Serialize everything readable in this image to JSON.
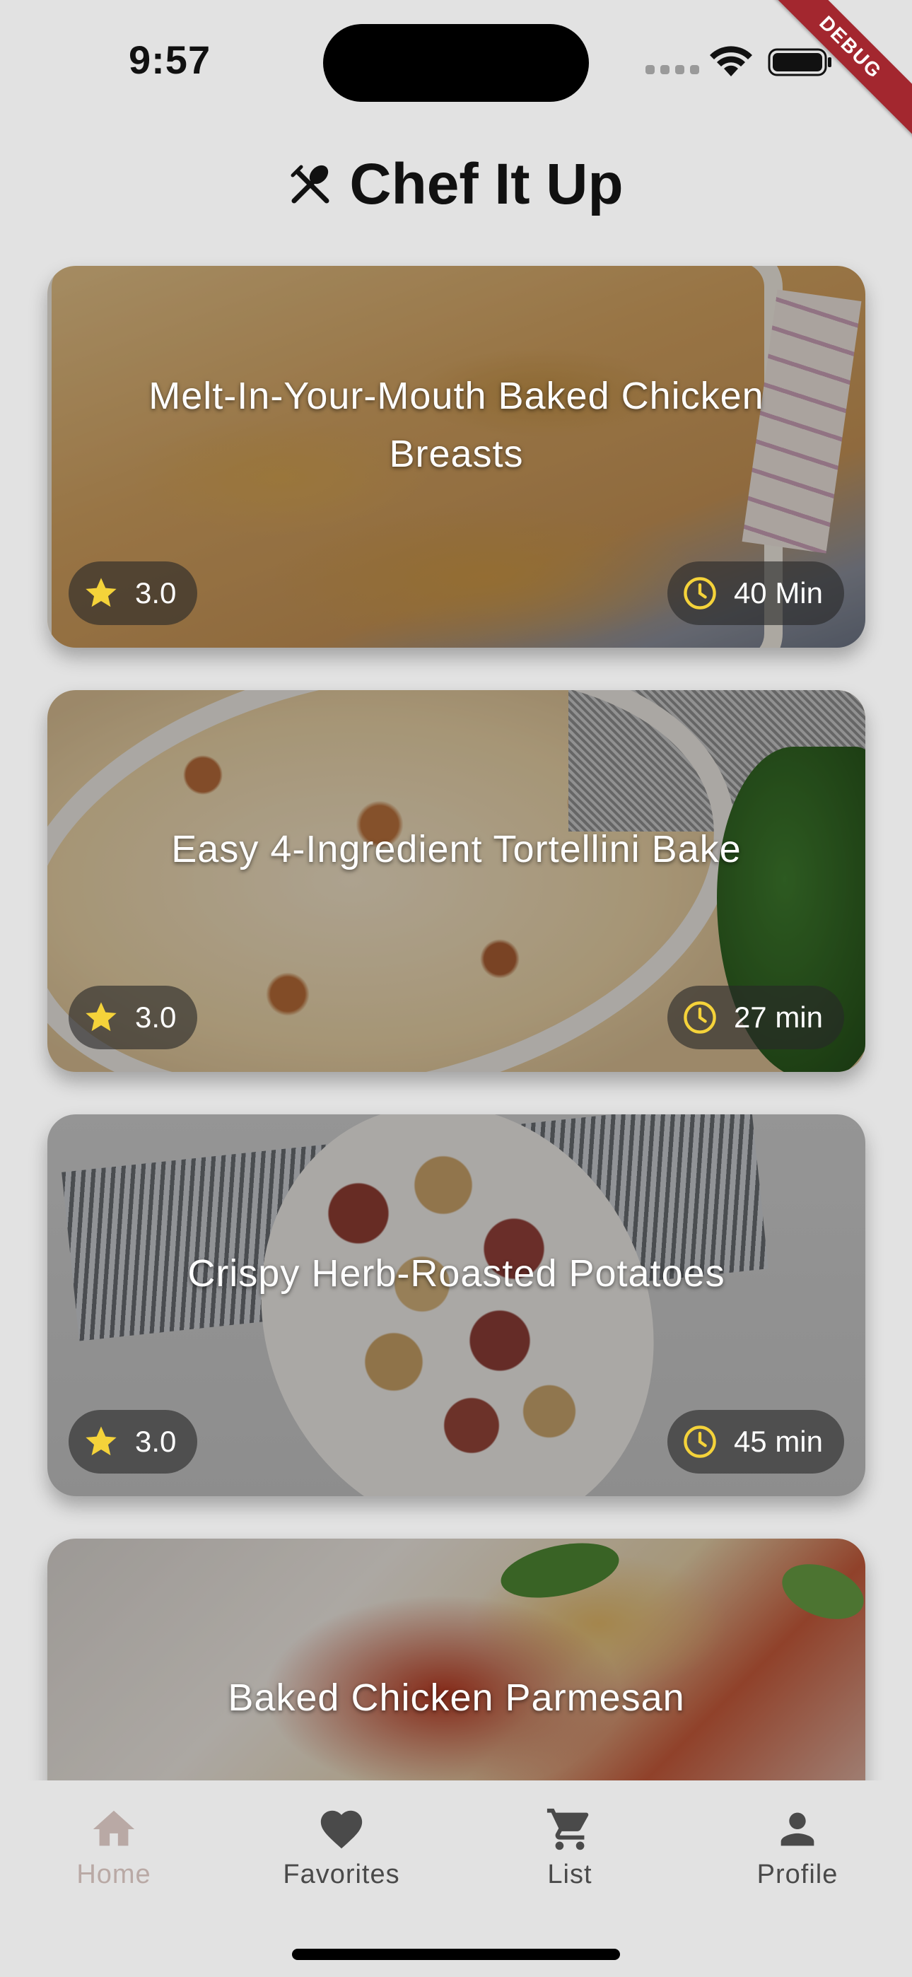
{
  "status_bar": {
    "time": "9:57",
    "debug_banner": "DEBUG"
  },
  "header": {
    "title": "Chef It Up",
    "icon": "utensils-crossed-icon"
  },
  "recipes": [
    {
      "title": "Melt-In-Your-Mouth Baked Chicken Breasts",
      "rating": "3.0",
      "time": "40 Min"
    },
    {
      "title": "Easy 4-Ingredient Tortellini Bake",
      "rating": "3.0",
      "time": "27 min"
    },
    {
      "title": "Crispy Herb-Roasted Potatoes",
      "rating": "3.0",
      "time": "45 min"
    },
    {
      "title": "Baked Chicken Parmesan"
    }
  ],
  "bottom_nav": {
    "items": [
      {
        "label": "Home",
        "icon": "home-icon",
        "active": true
      },
      {
        "label": "Favorites",
        "icon": "heart-icon",
        "active": false
      },
      {
        "label": "List",
        "icon": "cart-icon",
        "active": false
      },
      {
        "label": "Profile",
        "icon": "person-icon",
        "active": false
      }
    ]
  },
  "colors": {
    "background": "#e2e2e2",
    "star": "#f5d33a",
    "clock": "#f5d33a",
    "nav_active": "#b9a9a5",
    "nav_inactive": "#4a4a4a"
  }
}
